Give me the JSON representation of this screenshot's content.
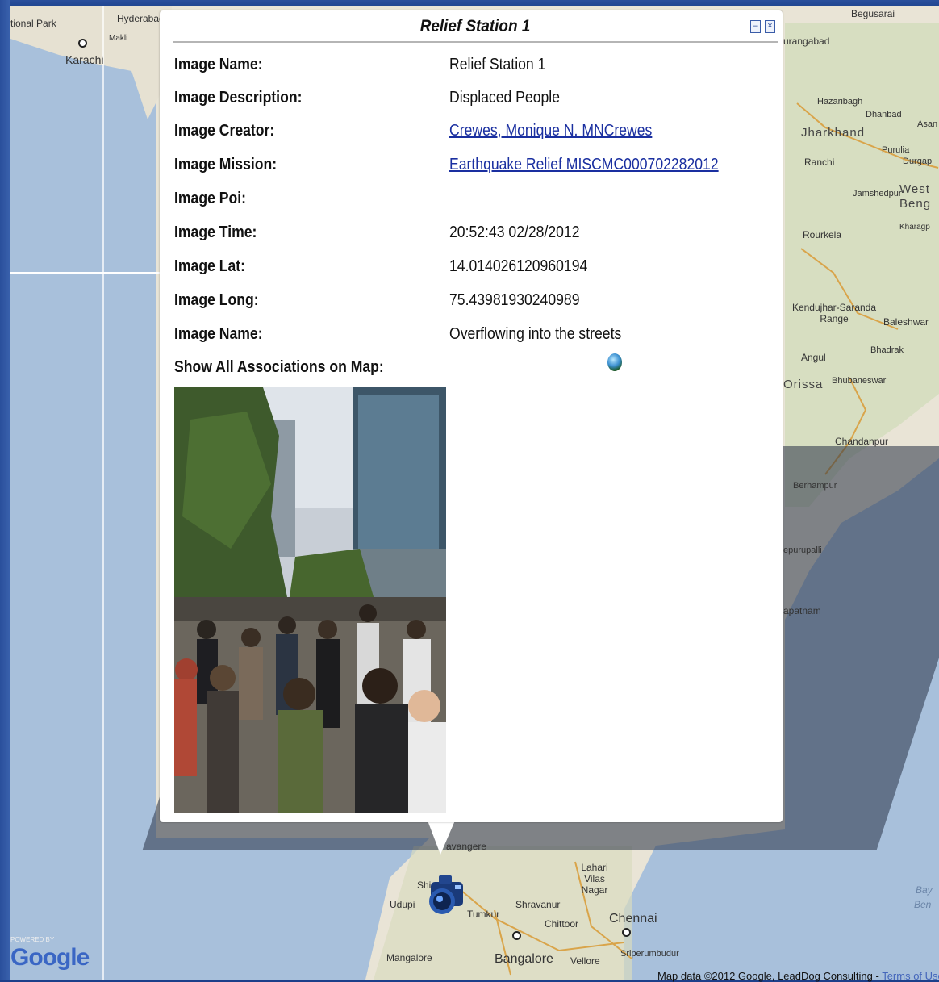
{
  "popup": {
    "title": "Relief Station 1",
    "rows": [
      {
        "label": "Image Name:",
        "value": "Relief Station 1"
      },
      {
        "label": "Image Description:",
        "value": "Displaced People"
      },
      {
        "label": "Image Creator:",
        "value": "Crewes, Monique N. MNCrewes"
      },
      {
        "label": "Image Mission:",
        "value": "Earthquake Relief MISCMC000702282012"
      },
      {
        "label": "Image Poi:",
        "value": ""
      },
      {
        "label": "Image Time:",
        "value": "20:52:43 02/28/2012"
      },
      {
        "label": "Image Lat:",
        "value": "14.014026120960194"
      },
      {
        "label": "Image Long:",
        "value": "75.43981930240989"
      },
      {
        "label": "Image Name:",
        "value": "Overflowing into the streets"
      }
    ],
    "associations_label": "Show All Associations on Map:",
    "icons": {
      "minimize": "minimize-icon",
      "close": "close-icon",
      "globe": "globe-icon"
    },
    "link_color": "#1a2fa0"
  },
  "map": {
    "cities": {
      "national_park": "tional Park",
      "hyderabad": "Hyderabad",
      "makli": "Makli",
      "karachi": "Karachi",
      "begusarai": "Begusarai",
      "aurangabad": "urangabad",
      "hazaribagh": "Hazaribagh",
      "dhanbad": "Dhanbad",
      "asan": "Asan",
      "jharkhand": "Jharkhand",
      "purulia": "Purulia",
      "ranchi": "Ranchi",
      "durgap": "Durgap",
      "jamshedpur": "Jamshedpur",
      "west_bengal": "West Beng",
      "kharagp": "Kharagp",
      "rourkela": "Rourkela",
      "kendujhar": "Kendujhar-Saranda Range",
      "baleshwar": "Baleshwar",
      "bhadrak": "Bhadrak",
      "angul": "Angul",
      "orissa": "Orissa",
      "bhubaneswar": "Bhubaneswar",
      "chandanpur": "Chandanpur",
      "berhampur": "Berhampur",
      "epurupalli": "epurupalli",
      "apatnam": "apatnam",
      "davangere": "avangere",
      "lahari": "Lahari Vilas Nagar",
      "udupi": "Udupi",
      "shimoga": "Shi",
      "shravanur": "Shravanur",
      "tumkur": "Tumkur",
      "chittoor": "Chittoor",
      "chennai": "Chennai",
      "mangalore": "Mangalore",
      "bangalore": "Bangalore",
      "vellore": "Vellore",
      "sriperumbudur": "Sriperumbudur",
      "bay": "Bay",
      "ben": "Ben"
    },
    "powered_by": "POWERED BY",
    "google": "Google",
    "map_data": "Map data ©2012 Google, LeadDog Consulting - ",
    "terms": "Terms of Use",
    "marker_icon": "camera-icon"
  }
}
